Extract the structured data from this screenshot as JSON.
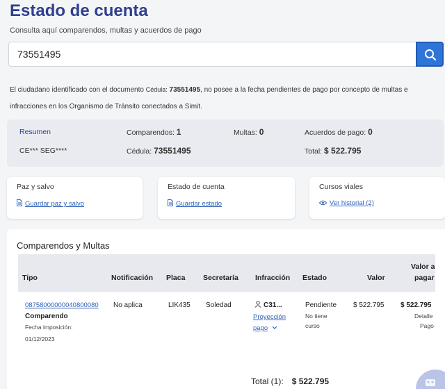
{
  "header": {
    "title": "Estado de cuenta",
    "subtitle": "Consulta aquí comparendos, multas y acuerdos de pago"
  },
  "search": {
    "value": "73551495"
  },
  "notice": {
    "part1": "El ciudadano identificado con el documento ",
    "doc_label": "Cédula:",
    "doc_number": "73551495",
    "part2": ", no posee a la fecha pendientes de pago por concepto de multas e",
    "line2": "infracciones en los Organismo de Tránsito conectados a Simit."
  },
  "summary": {
    "resumen_label": "Resumen",
    "name_masked": "CE*** SEG****",
    "comparendos_label": "Comparendos:",
    "comparendos_value": "1",
    "cedula_label": "Cédula:",
    "cedula_value": "73551495",
    "multas_label": "Multas:",
    "multas_value": "0",
    "acuerdos_label": "Acuerdos de pago:",
    "acuerdos_value": "0",
    "total_label": "Total:",
    "total_value": "$ 522.795"
  },
  "cards": [
    {
      "title": "Paz y salvo",
      "link": "Guardar paz y salvo"
    },
    {
      "title": "Estado de cuenta",
      "link": "Guardar estado"
    },
    {
      "title": "Cursos viales",
      "link": "Ver historial (2)"
    }
  ],
  "table": {
    "title": "Comparendos y Multas",
    "headers": {
      "tipo": "Tipo",
      "notificacion": "Notificación",
      "placa": "Placa",
      "secretaria": "Secretaría",
      "infraccion": "Infracción",
      "estado": "Estado",
      "valor": "Valor",
      "valor_pagar_1": "Valor a",
      "valor_pagar_2": "pagar"
    },
    "rows": [
      {
        "numero": "08758000000040800080",
        "tipo": "Comparendo",
        "fecha_label": "Fecha imposición:",
        "fecha": "01/12/2023",
        "notificacion": "No aplica",
        "placa": "LIK435",
        "secretaria": "Soledad",
        "infraccion": "C31...",
        "proyeccion_1": "Proyección",
        "proyeccion_2": "pago",
        "estado": "Pendiente",
        "curso_1": "No tiene",
        "curso_2": "curso",
        "valor": "$ 522.795",
        "valor_pagar": "$ 522.795",
        "detalle_1": "Detalle",
        "detalle_2": "Pago"
      }
    ],
    "total_label": "Total (1):",
    "total_value": "$ 522.795"
  },
  "colors": {
    "title": "#2f3f8f",
    "search_button": "#2f74d8",
    "link": "#2f5fb8",
    "summary_bg": "#e9ebf0"
  }
}
